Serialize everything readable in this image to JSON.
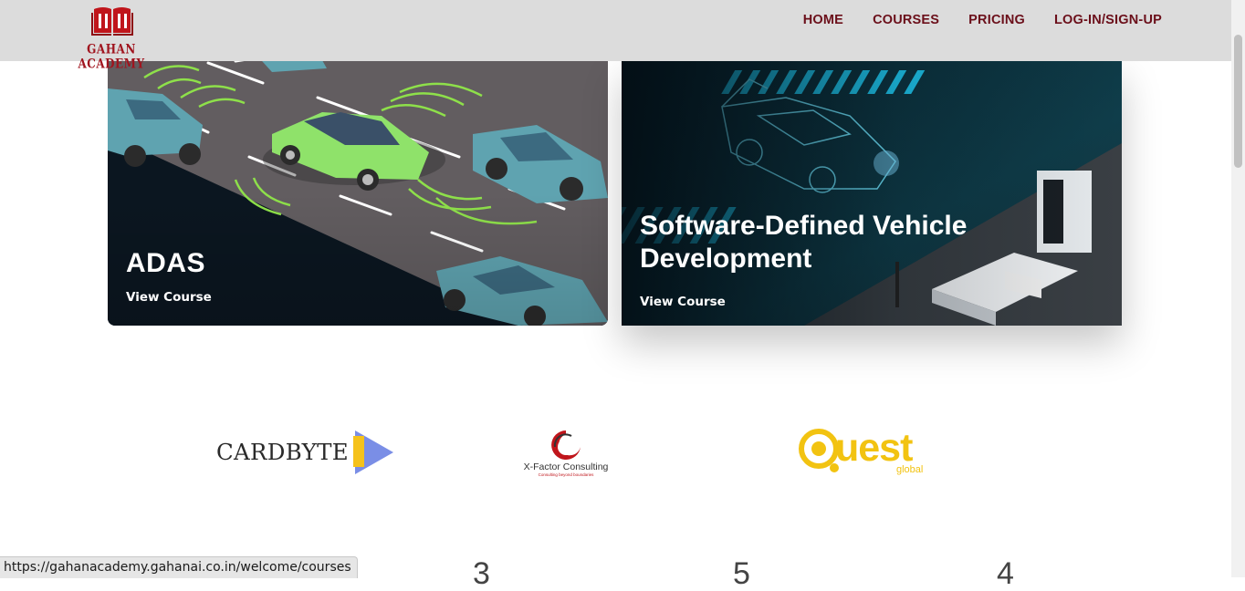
{
  "header": {
    "logo_text": "GAHAN ACADEMY",
    "nav": [
      "HOME",
      "COURSES",
      "PRICING",
      "LOG-IN/SIGN-UP"
    ]
  },
  "courses": [
    {
      "title": "ADAS",
      "link": "View Course"
    },
    {
      "title": "Software-Defined Vehicle Development",
      "link": "View Course"
    }
  ],
  "partners": {
    "cardbyte": "CARDBYTE",
    "xfactor_name": "X-Factor Consulting",
    "xfactor_tagline": "Consulting beyond boundaries",
    "quest_word": "uest",
    "quest_sub": "global"
  },
  "stats": [
    "3",
    "5",
    "4"
  ],
  "status_url": "https://gahanacademy.gahanai.co.in/welcome/courses",
  "colors": {
    "nav_bg": "#dcdcdc",
    "nav_text": "#6b0f1a",
    "brand_red": "#c0151b",
    "quest_yellow": "#f2c311"
  }
}
